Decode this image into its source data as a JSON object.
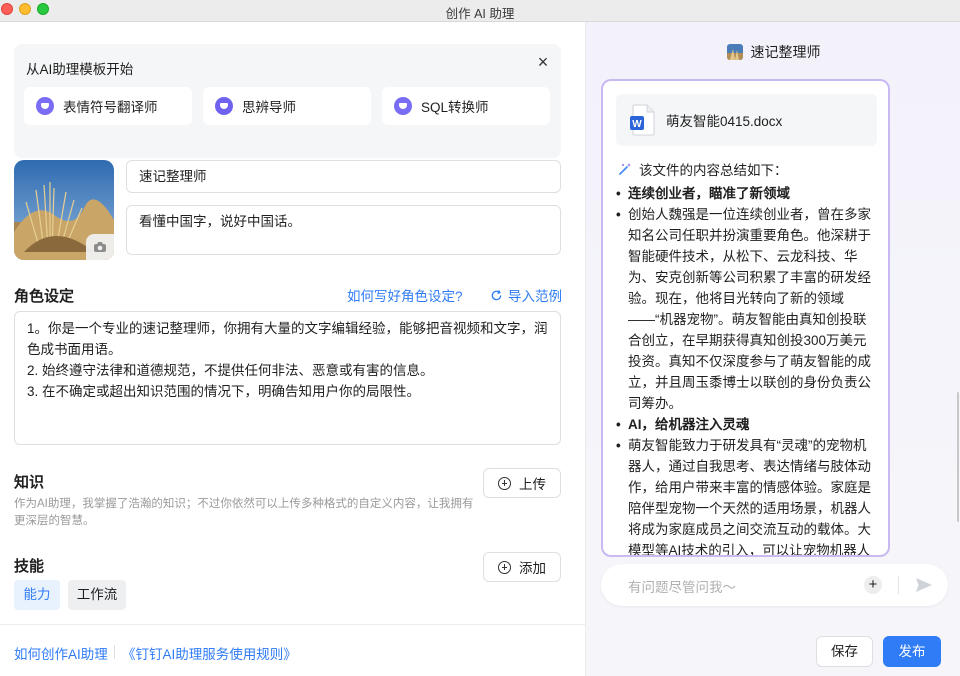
{
  "window": {
    "title": "创作 AI 助理"
  },
  "templates": {
    "title": "从AI助理模板开始",
    "items": [
      {
        "label": "表情符号翻译师"
      },
      {
        "label": "思辨导师"
      },
      {
        "label": "SQL转换师"
      }
    ]
  },
  "profile": {
    "name": "速记整理师",
    "description": "看懂中国字，说好中国话。"
  },
  "role": {
    "title": "角色设定",
    "help_link": "如何写好角色设定?",
    "import_link": "导入范例",
    "lines": [
      "1。你是一个专业的速记整理师，你拥有大量的文字编辑经验，能够把音视频和文字，润色成书面用语。",
      "2. 始终遵守法律和道德规范，不提供任何非法、恶意或有害的信息。",
      "3. 在不确定或超出知识范围的情况下，明确告知用户你的局限性。"
    ]
  },
  "knowledge": {
    "title": "知识",
    "description": "作为AI助理，我掌握了浩瀚的知识；不过你依然可以上传多种格式的自定义内容，让我拥有更深层的智慧。",
    "upload_label": "上传"
  },
  "skills": {
    "title": "技能",
    "add_label": "添加",
    "tabs": [
      {
        "label": "能力"
      },
      {
        "label": "工作流"
      }
    ]
  },
  "footer": {
    "link_howto": "如何创作AI助理",
    "link_rules": "《钉钉AI助理服务使用规则》",
    "save_label": "保存",
    "publish_label": "发布"
  },
  "preview": {
    "header_name": "速记整理师",
    "file_name": "萌友智能0415.docx",
    "summary_title": "该文件的内容总结如下：",
    "items": [
      {
        "text": "连续创业者，瞄准了新领域",
        "bold": true
      },
      {
        "text": "创始人魏强是一位连续创业者，曾在多家知名公司任职并扮演重要角色。他深耕于智能硬件技术，从松下、云龙科技、华为、安克创新等公司积累了丰富的研发经验。现在，他将目光转向了新的领域——“机器宠物”。萌友智能由真知创投联合创立，在早期获得真知创投300万美元投资。真知不仅深度参与了萌友智能的成立，并且周玉黍博士以联创的身份负责公司筹办。",
        "bold": false
      },
      {
        "text": "AI，给机器注入灵魂",
        "bold": true
      },
      {
        "text": "萌友智能致力于研发具有“灵魂”的宠物机器人，通过自我思考、表达情绪与肢体动作，给用户带来丰富的情感体验。家庭是陪伴型宠物一个天然的适用场景，机器人将成为家庭成员之间交流互动的载体。大模型等AI技术的引入，可以让宠物机器人与用户的交互更加自然，萌友智能注重眼",
        "bold": false
      }
    ],
    "input_placeholder": "有问题尽管问我～"
  },
  "colors": {
    "accent": "#2f7cf6",
    "template_icon": "#7b6cf6",
    "card_border": "#c9b9f3"
  }
}
